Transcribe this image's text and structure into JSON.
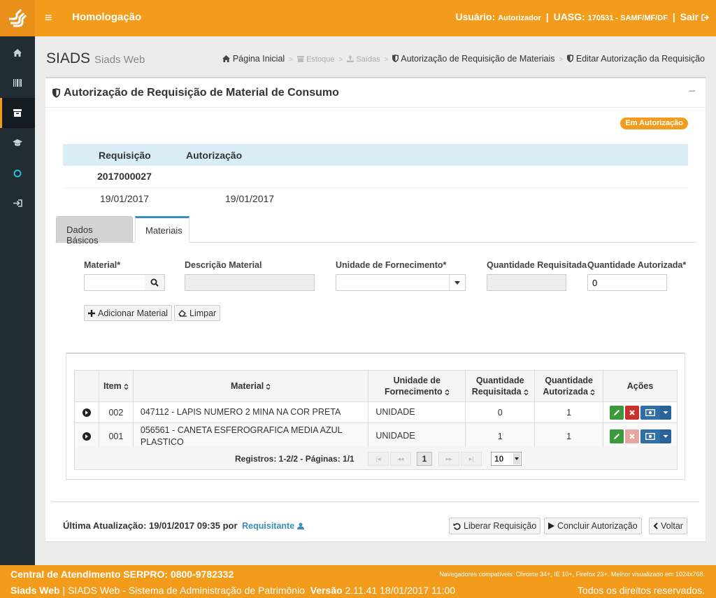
{
  "topbar": {
    "title": "Homologação",
    "user_label": "Usuário:",
    "user_name": "Autorizador",
    "uasg_label": "UASG:",
    "uasg_value": "170531 - SAMF/MF/DF",
    "logout_label": "Sair"
  },
  "sidebar": {
    "items": [
      {
        "icon": "home-icon"
      },
      {
        "icon": "barcode-icon"
      },
      {
        "icon": "inbox-icon",
        "active": true
      },
      {
        "icon": "graduation-cap-icon"
      },
      {
        "icon": "circle-icon"
      },
      {
        "icon": "sign-in-icon"
      }
    ]
  },
  "header": {
    "title": "SIADS",
    "subtitle": "Siads Web",
    "breadcrumb": [
      "Página Inicial",
      "Estoque",
      "Saídas",
      "Autorização de Requisição de Materiais",
      "Editar Autorização da Requisição"
    ]
  },
  "panel": {
    "title": "Autorização de Requisição de Material de Consumo",
    "collapse": "−",
    "status": "Em Autorização",
    "info": {
      "col_req": "Requisição",
      "col_aut": "Autorização",
      "number": "2017000027",
      "req_date": "19/01/2017",
      "aut_date": "19/01/2017"
    },
    "tabs": [
      "Dados Básicos",
      "Materiais"
    ]
  },
  "form": {
    "material_label": "Material*",
    "descricao_label": "Descrição Material",
    "unidade_label": "Unidade de Fornecimento*",
    "qtd_req_label": "Quantidade Requisitada",
    "qtd_aut_label": "Quantidade Autorizada*",
    "qtd_aut_value": "0",
    "add_button": "Adicionar Material",
    "clear_button": "Limpar"
  },
  "grid": {
    "headers": {
      "item": "Item",
      "material": "Material",
      "unidade_1": "Unidade de",
      "unidade_2": "Fornecimento",
      "qreq_1": "Quantidade",
      "qreq_2": "Requisitada",
      "qaut_1": "Quantidade",
      "qaut_2": "Autorizada",
      "acoes": "Ações"
    },
    "rows": [
      {
        "item": "002",
        "material": "047112 - LAPIS NUMERO 2 MINA NA COR PRETA",
        "unidade": "UNIDADE",
        "qreq": "0",
        "qaut": "1"
      },
      {
        "item": "001",
        "material": "056561 - CANETA ESFEROGRAFICA MEDIA AZUL PLASTICO",
        "unidade": "UNIDADE",
        "qreq": "1",
        "qaut": "1"
      }
    ],
    "pager": {
      "summary": "Registros: 1-2/2 - Páginas: 1/1",
      "current_page": "1",
      "page_size": "10"
    }
  },
  "footer_bar": {
    "update_label": "Última Atualização: 19/01/2017 09:35 por",
    "update_user": "Requisitante",
    "release_button": "Liberar Requisição",
    "conclude_button": "Concluir Autorização",
    "back_button": "Voltar"
  },
  "footer": {
    "phone": "Central de Atendimento SERPRO: 0800-9782332",
    "browsers": "Navegadores compatíveis: Chrome 34+, IE 10+, Firefox 23+. Melhor visualizado em 1024x768.",
    "app_name": "Siads Web",
    "app_desc": "| SIADS Web - Sistema de Administração de Patrimônio",
    "version_label": "Versão",
    "version_value": "2.11.41 18/01/2017 11:00",
    "rights": "Todos os direitos reservados."
  },
  "colors": {
    "brand_orange": "#f39c1c",
    "sidebar_dark": "#222c33",
    "link_blue": "#3c8dbc",
    "edit_green": "#3c9a3c",
    "delete_red": "#c9302c"
  }
}
